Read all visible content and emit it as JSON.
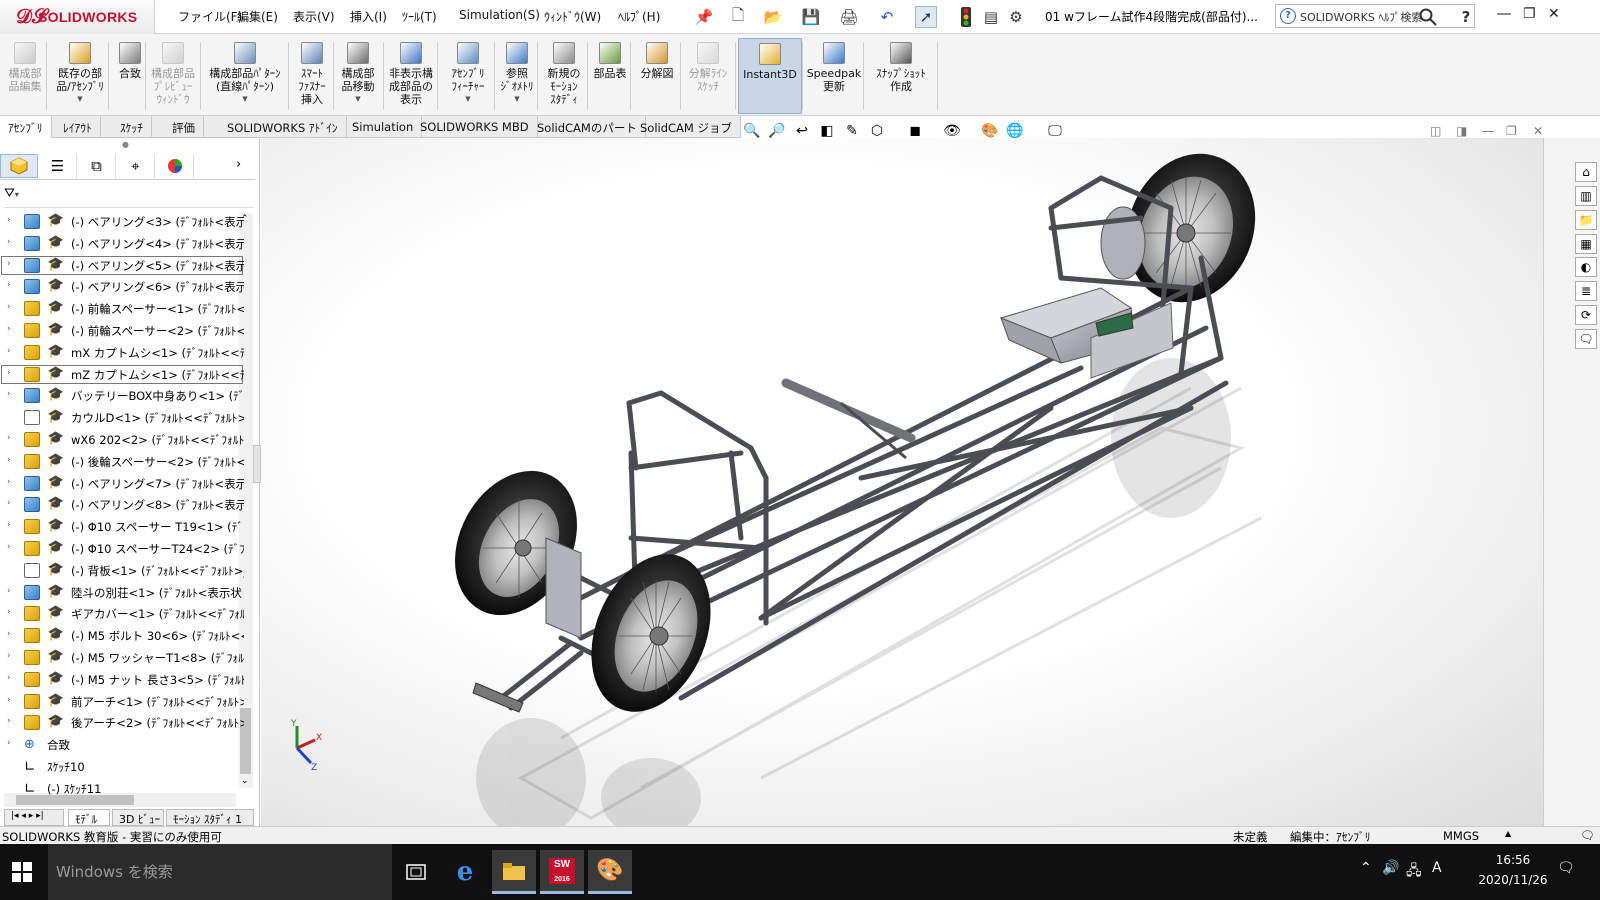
{
  "app": {
    "brand_symbol": "𝒟𝒮",
    "brand": "SOLIDWORKS"
  },
  "menu": [
    {
      "label": "ファイル(F)"
    },
    {
      "label": "編集(E)"
    },
    {
      "label": "表示(V)"
    },
    {
      "label": "挿入(I)"
    },
    {
      "label": "ﾂｰﾙ(T)"
    },
    {
      "label": "Simulation(S)"
    },
    {
      "label": "ｳｨﾝﾄﾞｳ(W)"
    },
    {
      "label": "ﾍﾙﾌﾟ(H)"
    }
  ],
  "document_title": "01 wフレーム試作4段階完成(部品付)...",
  "help_search_placeholder": "SOLIDWORKS ﾍﾙﾌﾟ検索",
  "commands": [
    {
      "label": "構成部\n品編集",
      "disabled": true
    },
    {
      "label": "既存の部\n品/ｱｾﾝﾌﾞﾘ",
      "dropdown": true
    },
    {
      "label": "合致"
    },
    {
      "label": "構成部品\nﾌﾟﾚﾋﾞｭｰ\nｳｨﾝﾄﾞｳ",
      "disabled": true
    },
    {
      "label": "構成部品ﾊﾟﾀｰﾝ\n(直線ﾊﾟﾀｰﾝ)",
      "dropdown": true
    },
    {
      "label": "ｽﾏｰﾄ\nﾌｧｽﾅｰ\n挿入"
    },
    {
      "label": "構成部\n品移動",
      "dropdown": true
    },
    {
      "label": "非表示構\n成部品の\n表示"
    },
    {
      "label": "ｱｾﾝﾌﾞﾘ\nﾌｨｰﾁｬｰ",
      "dropdown": true
    },
    {
      "label": "参照\nｼﾞｵﾒﾄﾘ",
      "dropdown": true
    },
    {
      "label": "新規の\nﾓｰｼｮﾝ\nｽﾀﾃﾞｨ"
    },
    {
      "label": "部品表"
    },
    {
      "label": "分解図"
    },
    {
      "label": "分解ﾗｲﾝ\nｽｹｯﾁ",
      "disabled": true
    },
    {
      "label": "Instant3D",
      "active": true
    },
    {
      "label": "Speedpak\n更新"
    },
    {
      "label": "ｽﾅｯﾌﾟｼｮｯﾄ\n作成"
    }
  ],
  "tabs": [
    {
      "label": "ｱｾﾝﾌﾞﾘ",
      "active": true
    },
    {
      "label": "ﾚｲｱｳﾄ"
    },
    {
      "label": "ｽｹｯﾁ"
    },
    {
      "label": "評価"
    },
    {
      "label": "SOLIDWORKS ｱﾄﾞｲﾝ"
    },
    {
      "label": "Simulation"
    },
    {
      "label": "SOLIDWORKS MBD"
    },
    {
      "label": "SolidCAMのパート"
    },
    {
      "label": "SolidCAM ジョブ"
    }
  ],
  "tree": [
    {
      "text": "(-) ベアリング<3> (ﾃﾞﾌｫﾙﾄ<表示状",
      "icon": "b"
    },
    {
      "text": "(-) ベアリング<4> (ﾃﾞﾌｫﾙﾄ<表示状",
      "icon": "b"
    },
    {
      "text": "(-) ベアリング<5> (ﾃﾞﾌｫﾙﾄ<表示状",
      "icon": "b",
      "sel": true
    },
    {
      "text": "(-) ベアリング<6> (ﾃﾞﾌｫﾙﾄ<表示状",
      "icon": "b"
    },
    {
      "text": "(-) 前輪スペーサー<1> (ﾃﾞﾌｫﾙﾄ<<ﾃﾞ",
      "icon": "y"
    },
    {
      "text": "(-) 前輪スペーサー<2> (ﾃﾞﾌｫﾙﾄ<<ﾃﾞ",
      "icon": "y"
    },
    {
      "text": "mX カプトムシ<1> (ﾃﾞﾌｫﾙﾄ<<ﾃﾞﾌｫ",
      "icon": "y"
    },
    {
      "text": "mZ カプトムシ<1> (ﾃﾞﾌｫﾙﾄ<<ﾃﾞﾌｫ",
      "icon": "y",
      "sel": true
    },
    {
      "text": "バッテリーBOX中身あり<1> (ﾃﾞﾌｫﾙ",
      "icon": "b"
    },
    {
      "text": "カウルD<1> (ﾃﾞﾌｫﾙﾄ<<ﾃﾞﾌｫﾙﾄ>_ﾃ",
      "icon": "w",
      "noexp": true
    },
    {
      "text": "wX6 202<2> (ﾃﾞﾌｫﾙﾄ<<ﾃﾞﾌｫﾙﾄ>",
      "icon": "y"
    },
    {
      "text": "(-) 後輪スペーサー<2> (ﾃﾞﾌｫﾙﾄ<<ﾃﾞ",
      "icon": "y"
    },
    {
      "text": "(-) ベアリング<7> (ﾃﾞﾌｫﾙﾄ<表示状",
      "icon": "b"
    },
    {
      "text": "(-) ベアリング<8> (ﾃﾞﾌｫﾙﾄ<表示状",
      "icon": "b"
    },
    {
      "text": "(-) Φ10 スペーサー T19<1> (ﾃﾞﾌｫﾙﾄ",
      "icon": "y"
    },
    {
      "text": "(-) Φ10 スペーサーT24<2> (ﾃﾞﾌｫﾙﾄ",
      "icon": "y"
    },
    {
      "text": "(-) 背板<1> (ﾃﾞﾌｫﾙﾄ<<ﾃﾞﾌｫﾙﾄ>_ﾃ",
      "icon": "w",
      "noexp": true
    },
    {
      "text": "陸斗の別荘<1> (ﾃﾞﾌｫﾙﾄ<表示状",
      "icon": "b"
    },
    {
      "text": "ギアカバー<1> (ﾃﾞﾌｫﾙﾄ<<ﾃﾞﾌｫﾙﾄ>",
      "icon": "y"
    },
    {
      "text": "(-) M5 ボルト 30<6> (ﾃﾞﾌｫﾙﾄ<<ﾃﾞ",
      "icon": "y"
    },
    {
      "text": "(-) M5 ワッシャーT1<8> (ﾃﾞﾌｫﾙﾄ<<",
      "icon": "y"
    },
    {
      "text": "(-) M5 ナット 長さ3<5> (ﾃﾞﾌｫﾙﾄ<<",
      "icon": "y"
    },
    {
      "text": "前アーチ<1> (ﾃﾞﾌｫﾙﾄ<<ﾃﾞﾌｫﾙﾄ>_ﾃ",
      "icon": "y"
    },
    {
      "text": "後アーチ<2> (ﾃﾞﾌｫﾙﾄ<<ﾃﾞﾌｫﾙﾄ>_ﾃ",
      "icon": "y"
    },
    {
      "text": "合致",
      "icon": "mate",
      "short": true
    },
    {
      "text": "ｽｹｯﾁ10",
      "icon": "sketch",
      "short": true,
      "noexp": true
    },
    {
      "text": "(-) ｽｹｯﾁ11",
      "icon": "sketch",
      "short": true,
      "noexp": true
    }
  ],
  "bottom_tabs": [
    "ﾓﾃﾞﾙ",
    "3D ﾋﾞｭｰ",
    "ﾓｰｼｮﾝ ｽﾀﾃﾞｨ 1"
  ],
  "axes": {
    "x": "X",
    "y": "Y",
    "z": "Z"
  },
  "status": {
    "left": "SOLIDWORKS 教育版 - 実習にのみ使用可",
    "undefined": "未定義",
    "editing": "編集中：ｱｾﾝﾌﾞﾘ",
    "units": "MMGS"
  },
  "taskbar": {
    "search_placeholder": "Windows を検索",
    "time": "16:56",
    "date": "2020/11/26",
    "sw_badge": "2016",
    "ime": "A"
  },
  "colors": {
    "brand": "#c8102e",
    "accent": "#9ab8dc"
  }
}
